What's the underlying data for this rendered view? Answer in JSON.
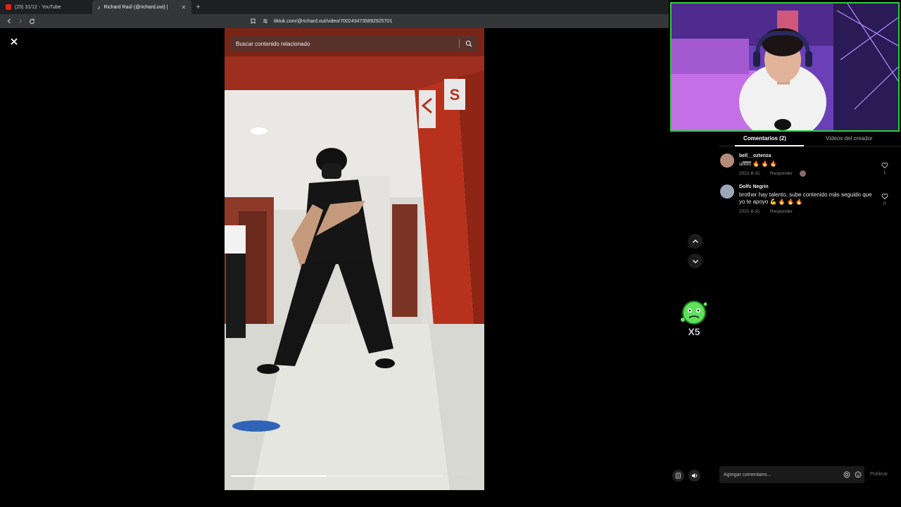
{
  "browser": {
    "tabs": [
      {
        "label": "(25) 31/12 - YouTube",
        "favicon_color": "#e62117",
        "active": false
      },
      {
        "label": "Richard Raúl (@richard.out) |",
        "favicon_color": "#ffffff",
        "active": true
      }
    ],
    "url": "tiktok.com/@richard.out/video/7002434735892925701"
  },
  "video": {
    "search_placeholder": "Buscar contenido relacionado",
    "timecode": "00:19/00:43",
    "progress": 0.45
  },
  "comments_panel": {
    "tab_comments": "Comentarios (2)",
    "tab_creator_videos": "Videos del creador",
    "comments": [
      {
        "user": "bell__oztenza",
        "text": "uffffff 🔥 🔥 🔥",
        "date": "2021-8-31",
        "reply": "Responder",
        "likes": "1",
        "avatar_color": "#b48a7a"
      },
      {
        "user": "Dolfs Negrin",
        "text": "brother hay talento, sube contenido más seguido que yo te apoyo 💪 🔥 🔥 🔥",
        "date": "2021-8-31",
        "reply": "Responder",
        "likes": "0",
        "avatar_color": "#9aa7b8"
      }
    ],
    "input_placeholder": "Agregar comentario...",
    "publish_label": "Publicar"
  },
  "sticker": {
    "text": "X5"
  },
  "colors": {
    "accent_green": "#2ecc40",
    "brand_red": "#fe2c55"
  }
}
